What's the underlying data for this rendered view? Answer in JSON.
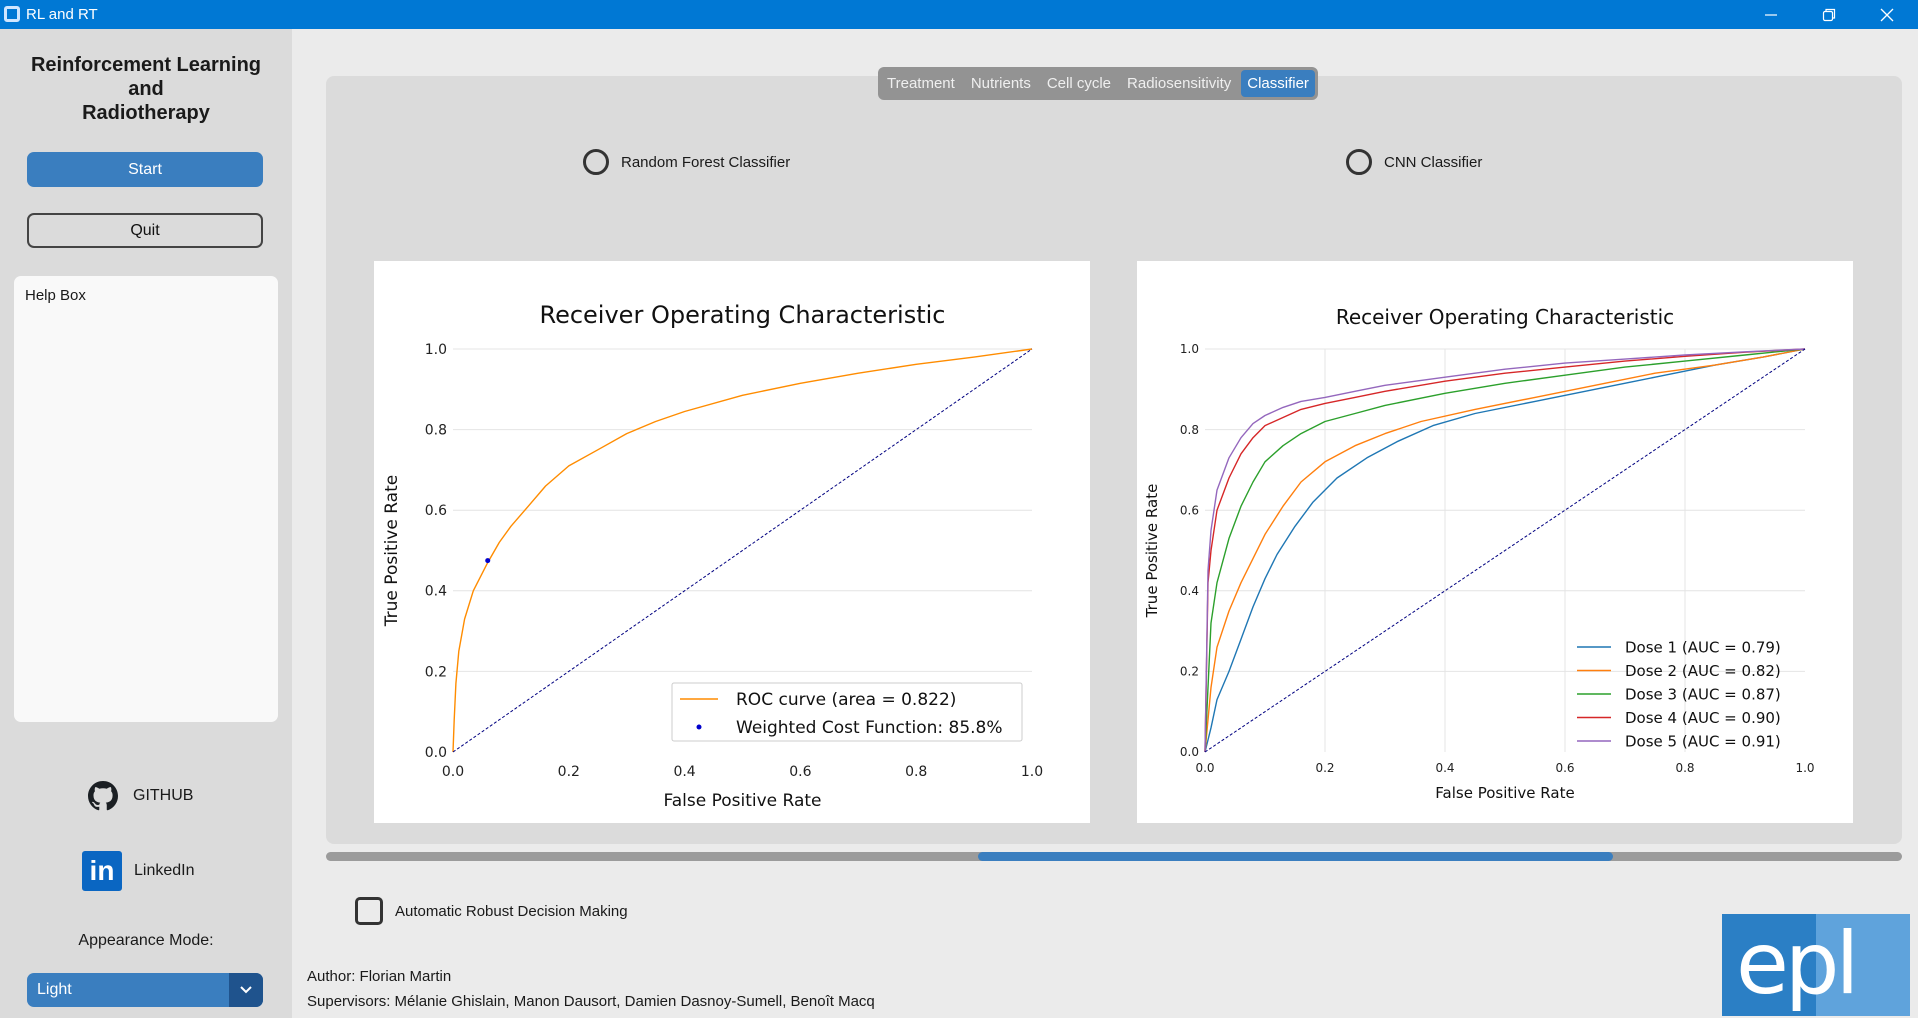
{
  "window": {
    "title": "RL and RT"
  },
  "sidebar": {
    "app_title_line1": "Reinforcement Learning",
    "app_title_line2": "and",
    "app_title_line3": "Radiotherapy",
    "start_label": "Start",
    "quit_label": "Quit",
    "help_box_label": "Help Box",
    "github_label": "GITHUB",
    "linkedin_label": "LinkedIn",
    "linkedin_icon_text": "in",
    "appearance_label": "Appearance Mode:",
    "appearance_value": "Light"
  },
  "tabs": [
    {
      "label": "Treatment",
      "active": false
    },
    {
      "label": "Nutrients",
      "active": false
    },
    {
      "label": "Cell cycle",
      "active": false
    },
    {
      "label": "Radiosensitivity",
      "active": false
    },
    {
      "label": "Classifier",
      "active": true
    }
  ],
  "classifier": {
    "option_rf": "Random Forest Classifier",
    "option_cnn": "CNN Classifier"
  },
  "checkbox_label": "Automatic Robust Decision Making",
  "credits": {
    "author": "Author: Florian Martin",
    "supervisors": "Supervisors: Mélanie Ghislain, Manon Dausort, Damien Dasnoy-Sumell, Benoît Macq"
  },
  "logo_text": "epl",
  "colors": {
    "accent": "#3a7ebf",
    "titlebar": "#0078d4"
  },
  "chart_data": [
    {
      "type": "line",
      "title": "Receiver Operating Characteristic",
      "xlabel": "False Positive Rate",
      "ylabel": "True Positive Rate",
      "xlim": [
        0,
        1
      ],
      "ylim": [
        0,
        1
      ],
      "ticks": [
        "0.0",
        "0.2",
        "0.4",
        "0.6",
        "0.8",
        "1.0"
      ],
      "legend_position": "lower-right",
      "grid": "horizontal",
      "series": [
        {
          "name": "ROC curve (area = 0.822)",
          "color": "#ff8c00",
          "x": [
            0,
            0.002,
            0.005,
            0.01,
            0.02,
            0.035,
            0.06,
            0.08,
            0.1,
            0.13,
            0.16,
            0.2,
            0.25,
            0.3,
            0.35,
            0.4,
            0.5,
            0.6,
            0.7,
            0.8,
            0.9,
            1.0
          ],
          "y": [
            0,
            0.08,
            0.17,
            0.25,
            0.33,
            0.4,
            0.47,
            0.52,
            0.56,
            0.61,
            0.66,
            0.71,
            0.75,
            0.79,
            0.82,
            0.845,
            0.885,
            0.915,
            0.94,
            0.962,
            0.98,
            1.0
          ]
        },
        {
          "name": "",
          "color": "#000080",
          "dashed": true,
          "x": [
            0,
            1
          ],
          "y": [
            0,
            1
          ]
        }
      ],
      "points": [
        {
          "name": "Weighted Cost Function: 85.8%",
          "x": 0.06,
          "y": 0.475,
          "color": "#0000cc"
        }
      ]
    },
    {
      "type": "line",
      "title": "Receiver Operating Characteristic",
      "xlabel": "False Positive Rate",
      "ylabel": "True Positive Rate",
      "xlim": [
        0,
        1
      ],
      "ylim": [
        0,
        1
      ],
      "ticks": [
        "0.0",
        "0.2",
        "0.4",
        "0.6",
        "0.8",
        "1.0"
      ],
      "legend_position": "lower-right",
      "grid": "both",
      "series": [
        {
          "name": "Dose 1 (AUC = 0.79)",
          "color": "#1f77b4",
          "x": [
            0,
            0.01,
            0.02,
            0.04,
            0.06,
            0.08,
            0.1,
            0.12,
            0.15,
            0.18,
            0.22,
            0.27,
            0.32,
            0.38,
            0.45,
            0.55,
            0.65,
            0.75,
            0.85,
            0.93,
            1.0
          ],
          "y": [
            0,
            0.06,
            0.13,
            0.2,
            0.28,
            0.36,
            0.43,
            0.49,
            0.56,
            0.62,
            0.68,
            0.73,
            0.77,
            0.81,
            0.84,
            0.87,
            0.9,
            0.93,
            0.96,
            0.98,
            1.0
          ]
        },
        {
          "name": "Dose 2 (AUC = 0.82)",
          "color": "#ff7f0e",
          "x": [
            0,
            0.01,
            0.02,
            0.04,
            0.06,
            0.08,
            0.1,
            0.13,
            0.16,
            0.2,
            0.25,
            0.3,
            0.36,
            0.45,
            0.55,
            0.65,
            0.75,
            0.85,
            0.93,
            1.0
          ],
          "y": [
            0,
            0.16,
            0.26,
            0.35,
            0.42,
            0.48,
            0.54,
            0.61,
            0.67,
            0.72,
            0.76,
            0.79,
            0.82,
            0.85,
            0.88,
            0.91,
            0.94,
            0.96,
            0.98,
            1.0
          ]
        },
        {
          "name": "Dose 3 (AUC = 0.87)",
          "color": "#2ca02c",
          "x": [
            0,
            0.01,
            0.02,
            0.04,
            0.06,
            0.08,
            0.1,
            0.13,
            0.16,
            0.2,
            0.25,
            0.3,
            0.4,
            0.5,
            0.6,
            0.7,
            0.8,
            0.9,
            1.0
          ],
          "y": [
            0,
            0.32,
            0.42,
            0.53,
            0.61,
            0.67,
            0.72,
            0.76,
            0.79,
            0.82,
            0.84,
            0.86,
            0.89,
            0.915,
            0.935,
            0.955,
            0.97,
            0.985,
            1.0
          ]
        },
        {
          "name": "Dose 4 (AUC = 0.90)",
          "color": "#d62728",
          "x": [
            0,
            0.005,
            0.01,
            0.02,
            0.04,
            0.06,
            0.08,
            0.1,
            0.13,
            0.16,
            0.2,
            0.25,
            0.3,
            0.4,
            0.5,
            0.6,
            0.7,
            0.8,
            0.9,
            1.0
          ],
          "y": [
            0,
            0.42,
            0.5,
            0.6,
            0.68,
            0.74,
            0.78,
            0.81,
            0.83,
            0.85,
            0.865,
            0.88,
            0.895,
            0.92,
            0.94,
            0.955,
            0.97,
            0.982,
            0.992,
            1.0
          ]
        },
        {
          "name": "Dose 5 (AUC = 0.91)",
          "color": "#9467bd",
          "x": [
            0,
            0.005,
            0.01,
            0.02,
            0.04,
            0.06,
            0.08,
            0.1,
            0.13,
            0.16,
            0.2,
            0.25,
            0.3,
            0.4,
            0.5,
            0.6,
            0.7,
            0.8,
            0.9,
            1.0
          ],
          "y": [
            0,
            0.45,
            0.55,
            0.65,
            0.73,
            0.78,
            0.815,
            0.835,
            0.855,
            0.87,
            0.88,
            0.895,
            0.91,
            0.93,
            0.95,
            0.965,
            0.975,
            0.985,
            0.993,
            1.0
          ]
        },
        {
          "name": "",
          "color": "#000080",
          "dashed": true,
          "x": [
            0,
            1
          ],
          "y": [
            0,
            1
          ]
        }
      ]
    }
  ]
}
